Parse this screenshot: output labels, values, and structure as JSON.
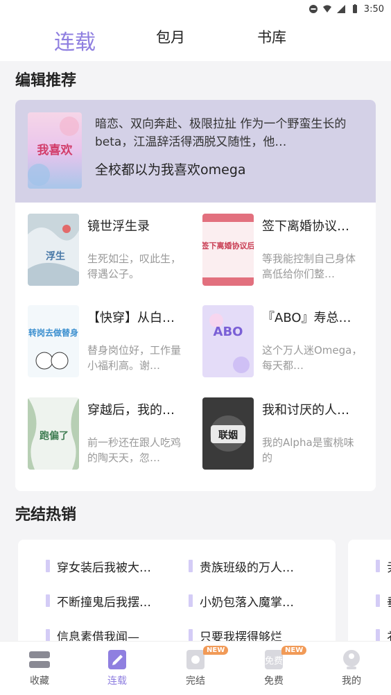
{
  "status_bar": {
    "time": "3:50"
  },
  "top_tabs": [
    {
      "label": "连载",
      "active": true
    },
    {
      "label": "包月",
      "active": false
    },
    {
      "label": "书库",
      "active": false
    }
  ],
  "editor_section": {
    "title": "编辑推荐",
    "featured": {
      "description": "暗恋、双向奔赴、极限拉扯 作为一个野蛮生长的beta，江温辞活得洒脱又随性，他…",
      "title": "全校都以为我喜欢omega",
      "cover_text": "我喜欢"
    },
    "books": [
      {
        "title": "镜世浮生录",
        "desc": "生死如尘，叹此生，得遇公子。",
        "cover_text": "浮生"
      },
      {
        "title": "签下离婚协议…",
        "desc": "等我能控制自己身体高低给你们整…",
        "cover_text": "签下离婚协议后"
      },
      {
        "title": "【快穿】从白…",
        "desc": "替身岗位好，工作量小福利高。谢…",
        "cover_text": "转岗去做替身"
      },
      {
        "title": "『ABO』寿总…",
        "desc": "这个万人迷Omega，每天都…",
        "cover_text": "ABO"
      },
      {
        "title": "穿越后，我的…",
        "desc": "前一秒还在跟人吃鸡的陶天天，忽…",
        "cover_text": "跑偏了"
      },
      {
        "title": "我和讨厌的人…",
        "desc": "我的Alpha是蜜桃味的",
        "cover_text": "联姻"
      }
    ]
  },
  "hot_section": {
    "title": "完结热销",
    "items": [
      "穿女装后我被大…",
      "贵族班级的万人…",
      "不断撞鬼后我摆…",
      "小奶包落入魔掌…",
      "信息素借我闻—",
      "只要我摆得够烂"
    ],
    "next_card_peek": [
      "尹",
      "垂",
      "礻"
    ]
  },
  "bottom_nav": [
    {
      "label": "收藏",
      "icon": "bookshelf-icon",
      "active": false,
      "badge": ""
    },
    {
      "label": "连载",
      "icon": "edit-book-icon",
      "active": true,
      "badge": ""
    },
    {
      "label": "完结",
      "icon": "finished-book-icon",
      "active": false,
      "badge": "NEW"
    },
    {
      "label": "免费",
      "icon": "free-icon",
      "active": false,
      "badge": "NEW"
    },
    {
      "label": "我的",
      "icon": "profile-icon",
      "active": false,
      "badge": ""
    }
  ],
  "colors": {
    "accent": "#8f7fe0",
    "featured_bg": "#d4d1e7",
    "badge": "#f19a57",
    "hot_bar": "#d4ccf6"
  }
}
